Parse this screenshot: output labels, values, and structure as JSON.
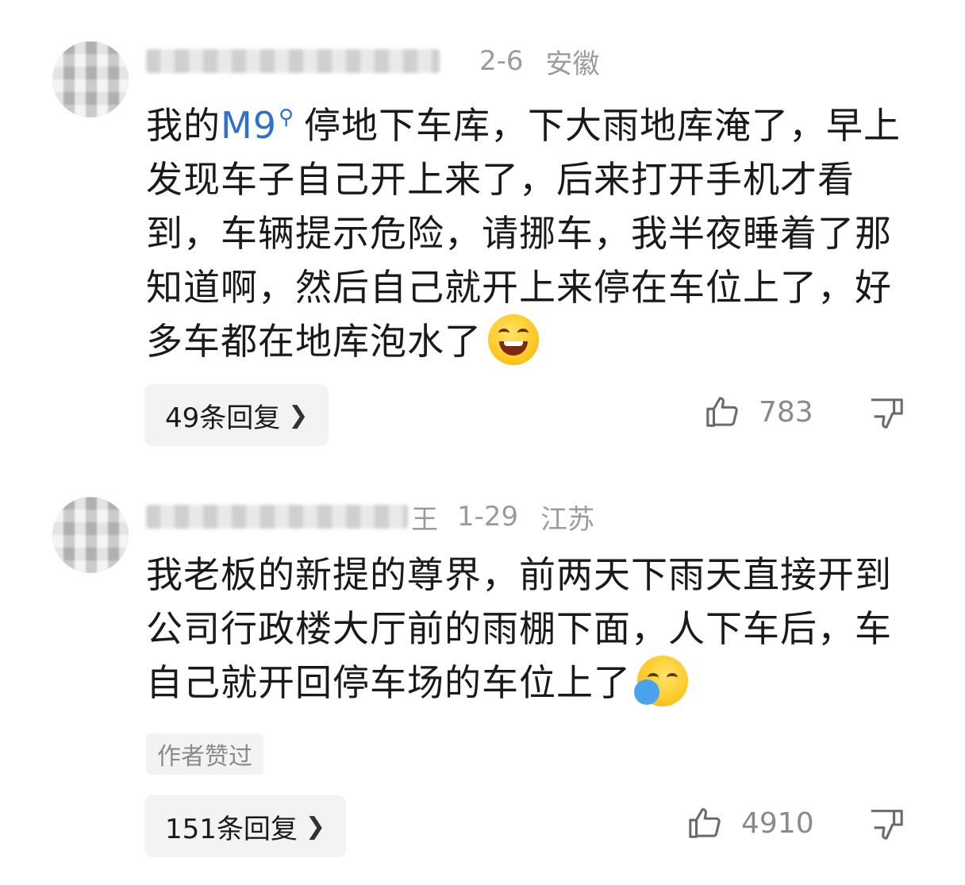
{
  "comments": [
    {
      "username_tail": "",
      "date": "2-6",
      "location": "安徽",
      "text_pre": "我的",
      "highlight": "M9",
      "highlight_icon": "search-icon",
      "text_post": "停地下车库，下大雨地库淹了，早上发现车子自己开上来了，后来打开手机才看到，车辆提示危险，请挪车，我半夜睡着了那知道啊，然后自己就开上来停在车位上了，好多车都在地库泡水了",
      "emoji": "laughing-emoji",
      "replies_label": "49条回复",
      "likes": "783"
    },
    {
      "username_tail": "王",
      "date": "1-29",
      "location": "江苏",
      "text": "我老板的新提的尊界，前两天下雨天直接开到公司行政楼大厅前的雨棚下面，人下车后，车自己就开回停车场的车位上了",
      "emoji": "tears-wiping-emoji",
      "author_badge": "作者赞过",
      "replies_label": "151条回复",
      "likes": "4910"
    }
  ],
  "colors": {
    "link": "#2f6fce",
    "meta": "#9b9b9b",
    "pill_bg": "#f3f3f3"
  }
}
